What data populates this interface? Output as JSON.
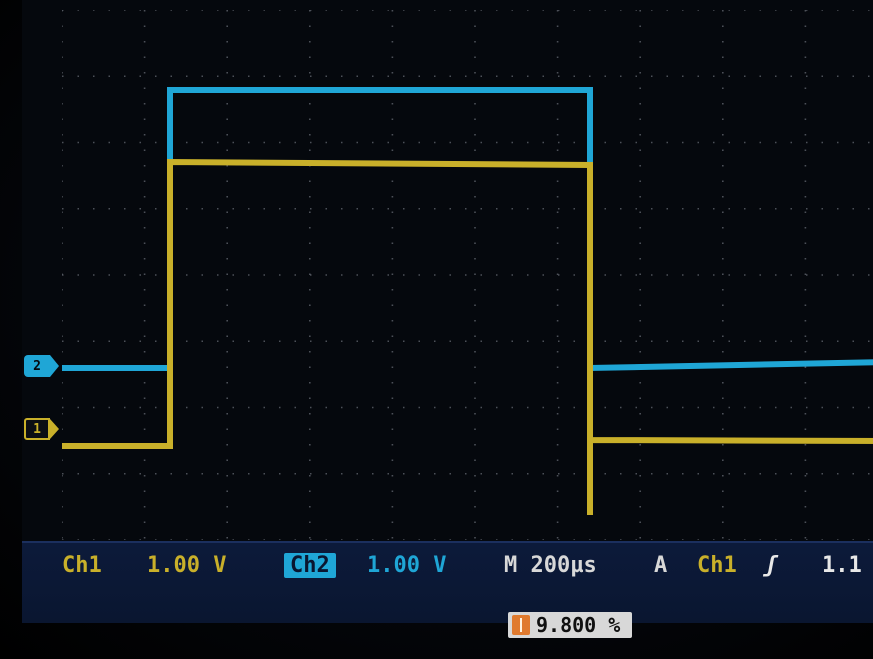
{
  "scope": {
    "channel1": {
      "label": "Ch1",
      "scale": "1.00 V",
      "color": "#c9b02a"
    },
    "channel2": {
      "label": "Ch2",
      "scale": "1.00 V",
      "color": "#1fa6d6"
    },
    "marker_ch2": "2",
    "marker_ch1": "1",
    "timebase": "M 200µs",
    "trigger": {
      "mode": "A",
      "source": "Ch1",
      "slope_icon": "rising-edge-icon",
      "slope_glyph": "ʃ",
      "level": "1.1"
    },
    "horizontal_position": "9.800 %"
  },
  "colors": {
    "background": "#05080d",
    "grid": "#6a6f78",
    "status_bar": "#0c1a3a"
  }
}
